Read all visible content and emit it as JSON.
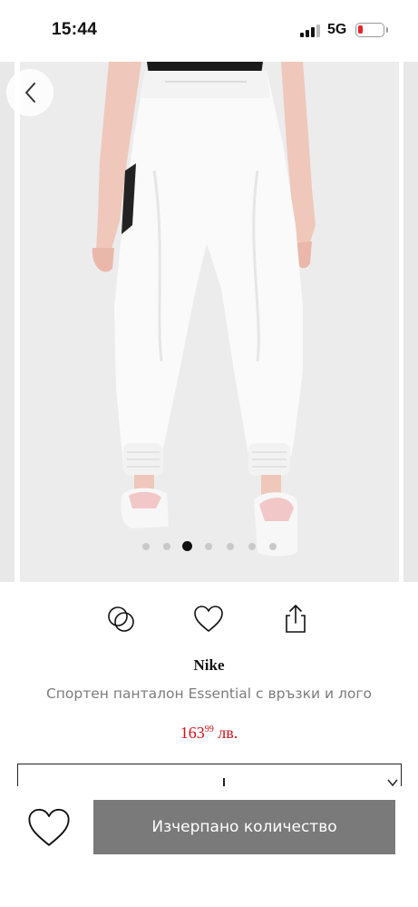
{
  "status_bar": {
    "time": "15:44",
    "network": "5G",
    "battery_level": 0.15,
    "battery_color": "#e5262c"
  },
  "gallery": {
    "image_subject": "white-jogger-pants",
    "page_count": 7,
    "active_page": 3
  },
  "actions": {
    "compare_icon": "compare-circles-icon",
    "wishlist_icon": "heart-icon",
    "share_icon": "share-icon"
  },
  "product": {
    "brand": "Nike",
    "name": "Спортен панталон Essential с връзки и лого",
    "price_main": "163",
    "price_cents": "99",
    "currency": " лв.",
    "price_color": "#d0111b"
  },
  "bottom_bar": {
    "button_label": "Изчерпано количество",
    "button_color": "#7a7a7a"
  }
}
